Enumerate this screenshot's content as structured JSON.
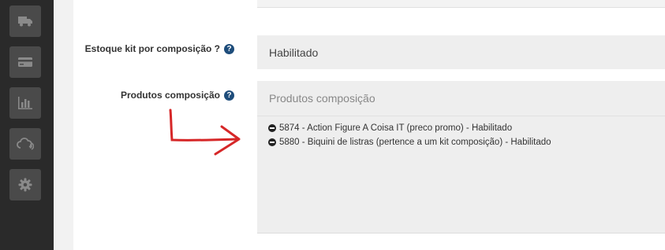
{
  "sidebar": {
    "items": [
      {
        "icon": "truck-icon"
      },
      {
        "icon": "credit-card-icon"
      },
      {
        "icon": "bar-chart-icon"
      },
      {
        "icon": "cloud-signal-icon"
      },
      {
        "icon": "gear-icon"
      }
    ]
  },
  "form": {
    "kit_label": "Estoque kit por composição ?",
    "kit_value": "Habilitado",
    "products_label": "Produtos composição",
    "products_placeholder": "Produtos composição",
    "products": [
      "5874 - Action Figure A Coisa IT (preco promo) - Habilitado",
      "5880 - Biquini de listras (pertence a um kit composição) - Habilitado"
    ]
  },
  "colors": {
    "sidebar_bg": "#2a2a2a",
    "sidebar_button": "#4a4a4a",
    "help_icon": "#1e4d7b",
    "annotation_arrow": "#d62728"
  }
}
